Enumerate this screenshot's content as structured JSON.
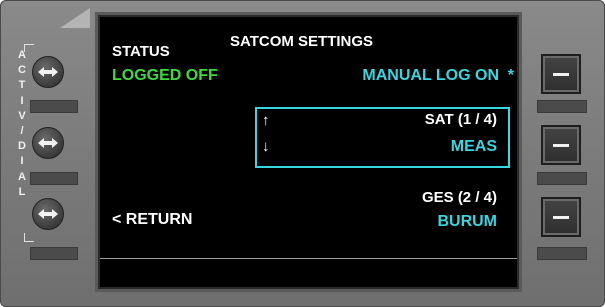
{
  "screen": {
    "title": "SATCOM SETTINGS",
    "status": {
      "label": "STATUS",
      "value": "LOGGED OFF"
    },
    "manual_logon": {
      "label": "MANUAL LOG ON",
      "marker": "*"
    },
    "sat": {
      "label": "SAT (1 / 4)",
      "value": "MEAS",
      "up_arrow": "↑",
      "down_arrow": "↓"
    },
    "ges": {
      "label": "GES (2 / 4)",
      "value": "BURUM"
    },
    "return_label": "< RETURN"
  },
  "left_panel": {
    "side_label_letters": [
      "A",
      "C",
      "T",
      "I",
      "V",
      "/",
      "D",
      "I",
      "A",
      "L"
    ],
    "knob_icon": "double-arrow-horizontal-icon"
  },
  "right_panel": {
    "key_icon": "dash-icon"
  },
  "colors": {
    "screen_bg": "#000000",
    "white_text": "#ffffff",
    "green_text": "#3ddc3d",
    "cyan_text": "#35d7e0",
    "bezel": "#7b7b7b"
  }
}
